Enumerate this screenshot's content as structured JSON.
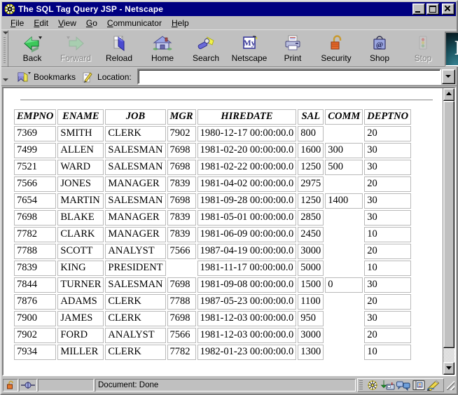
{
  "window": {
    "title": "The SQL Tag Query JSP - Netscape",
    "icon": "netscape-wheel-icon",
    "controls": {
      "minimize": "minimize-button",
      "maximize": "maximize-button",
      "close": "close-button"
    }
  },
  "menubar": {
    "items": [
      {
        "label": "File",
        "mnemonic": "F"
      },
      {
        "label": "Edit",
        "mnemonic": "E"
      },
      {
        "label": "View",
        "mnemonic": "V"
      },
      {
        "label": "Go",
        "mnemonic": "G"
      },
      {
        "label": "Communicator",
        "mnemonic": "C"
      },
      {
        "label": "Help",
        "mnemonic": "H"
      }
    ]
  },
  "toolbar": {
    "buttons": [
      {
        "label": "Back",
        "icon": "back-arrow-icon",
        "enabled": true
      },
      {
        "label": "Forward",
        "icon": "forward-arrow-icon",
        "enabled": false
      },
      {
        "label": "Reload",
        "icon": "reload-icon",
        "enabled": true
      },
      {
        "label": "Home",
        "icon": "home-icon",
        "enabled": true
      },
      {
        "label": "Search",
        "icon": "search-flashlight-icon",
        "enabled": true
      },
      {
        "label": "Netscape",
        "icon": "my-netscape-icon",
        "enabled": true
      },
      {
        "label": "Print",
        "icon": "printer-icon",
        "enabled": true
      },
      {
        "label": "Security",
        "icon": "padlock-icon",
        "enabled": true
      },
      {
        "label": "Shop",
        "icon": "shopping-bag-icon",
        "enabled": true
      },
      {
        "label": "Stop",
        "icon": "stop-sign-icon",
        "enabled": false
      }
    ],
    "logo": {
      "letter": "N",
      "name": "netscape-logo"
    }
  },
  "locationbar": {
    "bookmarks_label": "Bookmarks",
    "bookmarks_icon": "bookmark-icon",
    "location_label": "Location:",
    "location_icon": "page-quill-icon",
    "location_value": "",
    "location_placeholder": ""
  },
  "statusbar": {
    "security_icon": "unlocked-padlock-icon",
    "connection_icon": "connection-icon",
    "message": "Document: Done",
    "component_bar": [
      {
        "icon": "navigator-icon",
        "label": "Navigator"
      },
      {
        "icon": "mailbox-icon",
        "label": "Inbox"
      },
      {
        "icon": "discussions-icon",
        "label": "Discussions"
      },
      {
        "icon": "address-book-icon",
        "label": "Address Book"
      },
      {
        "icon": "composer-icon",
        "label": "Composer"
      }
    ],
    "resize_grip": "resize-grip"
  },
  "scrollbar": {
    "up_arrow": "scroll-up-arrow",
    "down_arrow": "scroll-down-arrow",
    "thumb": "scroll-thumb"
  },
  "page": {
    "table": {
      "columns": [
        "EMPNO",
        "ENAME",
        "JOB",
        "MGR",
        "HIREDATE",
        "SAL",
        "COMM",
        "DEPTNO"
      ],
      "rows": [
        [
          "7369",
          "SMITH",
          "CLERK",
          "7902",
          "1980-12-17 00:00:00.0",
          "800",
          "",
          "20"
        ],
        [
          "7499",
          "ALLEN",
          "SALESMAN",
          "7698",
          "1981-02-20 00:00:00.0",
          "1600",
          "300",
          "30"
        ],
        [
          "7521",
          "WARD",
          "SALESMAN",
          "7698",
          "1981-02-22 00:00:00.0",
          "1250",
          "500",
          "30"
        ],
        [
          "7566",
          "JONES",
          "MANAGER",
          "7839",
          "1981-04-02 00:00:00.0",
          "2975",
          "",
          "20"
        ],
        [
          "7654",
          "MARTIN",
          "SALESMAN",
          "7698",
          "1981-09-28 00:00:00.0",
          "1250",
          "1400",
          "30"
        ],
        [
          "7698",
          "BLAKE",
          "MANAGER",
          "7839",
          "1981-05-01 00:00:00.0",
          "2850",
          "",
          "30"
        ],
        [
          "7782",
          "CLARK",
          "MANAGER",
          "7839",
          "1981-06-09 00:00:00.0",
          "2450",
          "",
          "10"
        ],
        [
          "7788",
          "SCOTT",
          "ANALYST",
          "7566",
          "1987-04-19 00:00:00.0",
          "3000",
          "",
          "20"
        ],
        [
          "7839",
          "KING",
          "PRESIDENT",
          "",
          "1981-11-17 00:00:00.0",
          "5000",
          "",
          "10"
        ],
        [
          "7844",
          "TURNER",
          "SALESMAN",
          "7698",
          "1981-09-08 00:00:00.0",
          "1500",
          "0",
          "30"
        ],
        [
          "7876",
          "ADAMS",
          "CLERK",
          "7788",
          "1987-05-23 00:00:00.0",
          "1100",
          "",
          "20"
        ],
        [
          "7900",
          "JAMES",
          "CLERK",
          "7698",
          "1981-12-03 00:00:00.0",
          "950",
          "",
          "30"
        ],
        [
          "7902",
          "FORD",
          "ANALYST",
          "7566",
          "1981-12-03 00:00:00.0",
          "3000",
          "",
          "20"
        ],
        [
          "7934",
          "MILLER",
          "CLERK",
          "7782",
          "1982-01-23 00:00:00.0",
          "1300",
          "",
          "10"
        ]
      ]
    }
  },
  "colors": {
    "titlebar": "#000080",
    "chrome": "#c0c0c0",
    "page_background": "#ffffff",
    "table_border": "#b9b9b9",
    "text": "#000000",
    "disabled_text": "#808080"
  }
}
